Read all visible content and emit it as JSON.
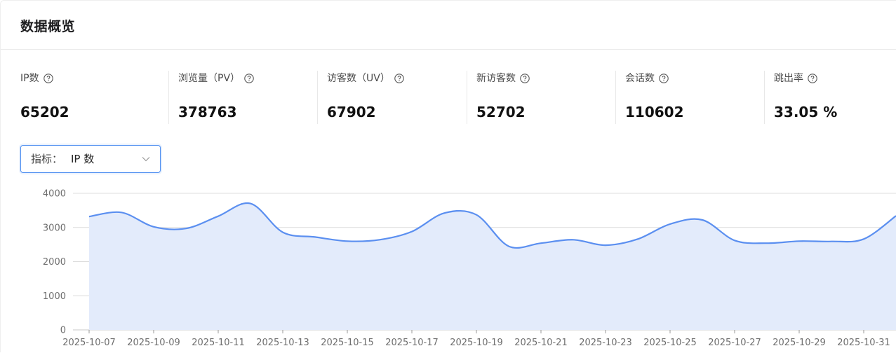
{
  "header": {
    "title": "数据概览"
  },
  "metrics": [
    {
      "label": "IP数",
      "value": "65202"
    },
    {
      "label": "浏览量（PV）",
      "value": "378763"
    },
    {
      "label": "访客数（UV）",
      "value": "67902"
    },
    {
      "label": "新访客数",
      "value": "52702"
    },
    {
      "label": "会话数",
      "value": "110602"
    },
    {
      "label": "跳出率",
      "value": "33.05 %"
    }
  ],
  "selector": {
    "prefix": "指标：",
    "value": "IP 数"
  },
  "colors": {
    "line": "#5b8ff0",
    "area": "#e3ebfb",
    "accent": "#4a8cf0"
  },
  "chart_data": {
    "type": "area",
    "ylim": [
      0,
      4000
    ],
    "yticks": [
      0,
      1000,
      2000,
      3000,
      4000
    ],
    "x": [
      "2025-10-07",
      "2025-10-08",
      "2025-10-09",
      "2025-10-10",
      "2025-10-11",
      "2025-10-12",
      "2025-10-13",
      "2025-10-14",
      "2025-10-15",
      "2025-10-16",
      "2025-10-17",
      "2025-10-18",
      "2025-10-19",
      "2025-10-20",
      "2025-10-21",
      "2025-10-22",
      "2025-10-23",
      "2025-10-24",
      "2025-10-25",
      "2025-10-26",
      "2025-10-27",
      "2025-10-28",
      "2025-10-29",
      "2025-10-30",
      "2025-10-31",
      "2025-11-01"
    ],
    "x_tick_labels": [
      "2025-10-07",
      "2025-10-09",
      "2025-10-11",
      "2025-10-13",
      "2025-10-15",
      "2025-10-17",
      "2025-10-19",
      "2025-10-21",
      "2025-10-23",
      "2025-10-25",
      "2025-10-27",
      "2025-10-29",
      "2025-10-31"
    ],
    "values": [
      3320,
      3440,
      3020,
      2970,
      3330,
      3700,
      2860,
      2720,
      2600,
      2640,
      2880,
      3420,
      3370,
      2450,
      2540,
      2640,
      2480,
      2660,
      3100,
      3220,
      2620,
      2540,
      2600,
      2590,
      2660,
      3340
    ],
    "grid": true
  }
}
